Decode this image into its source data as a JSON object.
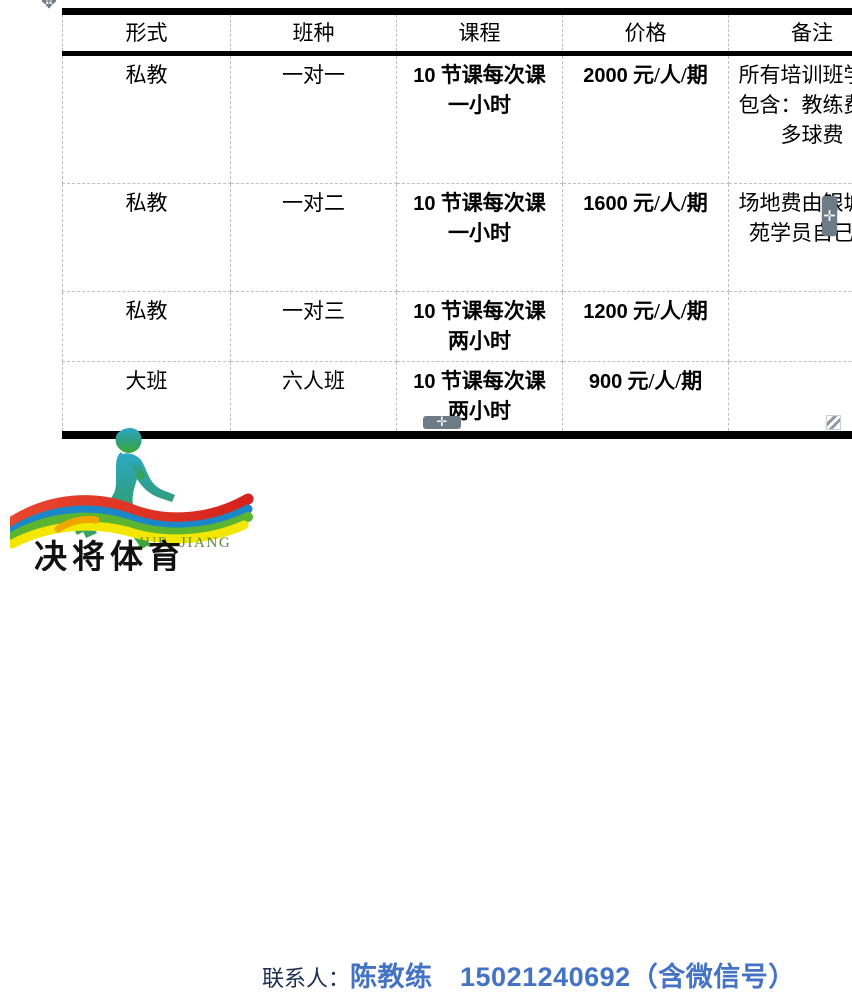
{
  "document": {
    "table": {
      "columns": [
        "形式",
        "班种",
        "课程",
        "价格",
        "备注"
      ],
      "rows": [
        {
          "form": "私教",
          "class_type": "一对一",
          "course": "10 节课每次课一小时",
          "course_num": "10",
          "course_text": "节课每次课一小时",
          "price": "2000 元/人/期",
          "price_num": "2000",
          "price_unit": "元/人/期",
          "note": "所有培训班学费包含：教练费和多球费"
        },
        {
          "form": "私教",
          "class_type": "一对二",
          "course": "10 节课每次课一小时",
          "course_num": "10",
          "course_text": "节课每次课一小时",
          "price": "1600 元/人/期",
          "price_num": "1600",
          "price_unit": "元/人/期",
          "note": "场地费由银城东苑学员自己付"
        },
        {
          "form": "私教",
          "class_type": "一对三",
          "course": "10 节课每次课两小时",
          "course_num": "10",
          "course_text": "节课每次课两小时",
          "price": "1200 元/人/期",
          "price_num": "1200",
          "price_unit": "元/人/期",
          "note": ""
        },
        {
          "form": "大班",
          "class_type": "六人班",
          "course": "10 节课每次课两小时",
          "course_num": "10",
          "course_text": "节课每次课两小时",
          "price": "900 元/人/期",
          "price_num": "900",
          "price_unit": "元/人/期",
          "note": ""
        }
      ]
    },
    "handles": {
      "move": "✥",
      "insert_row": "✛",
      "insert_column": "✛"
    },
    "logo": {
      "brand_cn": "决将体育",
      "brand_en_1": "JUE",
      "brand_en_2": "JIANG",
      "colors": {
        "runner_top": "#2ba9c8",
        "runner_bottom": "#3aa935",
        "ribbon_red": "#e03127",
        "ribbon_green": "#5cb531",
        "ribbon_yellow": "#f3e600",
        "ribbon_blue": "#1b86c8",
        "ribbon_orange": "#f0a500",
        "brand_cn_color": "#111111",
        "brand_en_color": "#5a8a3a"
      }
    },
    "contact": {
      "label": "联系人：",
      "value": "陈教练　15021240692（含微信号）",
      "label_color": "#1f2f52",
      "value_color": "#4472c4"
    }
  }
}
